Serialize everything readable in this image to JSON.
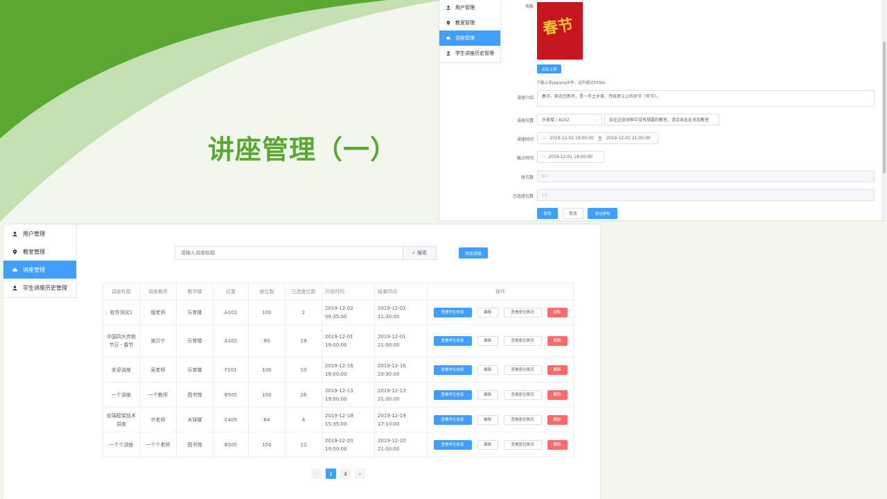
{
  "slide": {
    "title": "讲座管理（一）"
  },
  "colors": {
    "accent": "#409eff",
    "danger": "#f56c6c",
    "brand_green": "#5aa832"
  },
  "top_screenshot": {
    "menu": [
      {
        "label": "用户管理",
        "icon": "user-icon"
      },
      {
        "label": "教室管理",
        "icon": "location-icon"
      },
      {
        "label": "讲座管理",
        "icon": "cloud-icon",
        "active": true
      },
      {
        "label": "学生讲座历史管理",
        "icon": "user-icon"
      }
    ],
    "form": {
      "poster_label": "海报",
      "poster_text": "春节",
      "upload_button": "点击上传",
      "upload_tip": "只能上传jpg/png文件，且不超过500kb",
      "intro_label": "讲座介绍",
      "intro_value": "春节，即农历新年，是一年之岁首、传统意义上的岁节（年节）。",
      "location_label": "讲座位置",
      "location_value": "乐育楼 / A102",
      "location_tip": "如左边选项框中没有想要的教室，请点击此处添加教室",
      "time_label": "讲座时间",
      "time_start": "2019-12-01 19:00:00",
      "time_sep": "至",
      "time_end": "2019-12-01 21:00:00",
      "deadline_label": "截止时间",
      "deadline_value": "2019-12-01 18:00:00",
      "seats_label": "座位数",
      "seats_value": "60",
      "selected_label": "已选座位数",
      "selected_value": "19",
      "btn_modify": "修改",
      "btn_cancel": "取消",
      "btn_seat": "座位排布"
    }
  },
  "bottom_screenshot": {
    "menu": [
      {
        "label": "用户管理",
        "icon": "user-icon"
      },
      {
        "label": "教室管理",
        "icon": "location-icon"
      },
      {
        "label": "讲座管理",
        "icon": "cloud-icon",
        "active": true
      },
      {
        "label": "学生讲座历史管理",
        "icon": "user-icon"
      }
    ],
    "search": {
      "placeholder": "请输入讲座标题",
      "button": "搜索"
    },
    "add_button": "添加讲座",
    "table": {
      "headers": [
        "讲座标题",
        "讲座教师",
        "教学楼",
        "位置",
        "座位数",
        "已选座位数",
        "开始时间",
        "结束时间",
        "操作"
      ],
      "row_buttons": {
        "view": "查看学生信息",
        "edit": "编辑",
        "seats": "查看座位情况",
        "delete": "删除"
      },
      "rows": [
        {
          "title": "软件测试1",
          "teacher": "程老师",
          "building": "乐育楼",
          "room": "A102",
          "seats": "100",
          "selected": "2",
          "start": "2019-12-02 09:35:00",
          "end": "2019-12-02 11:30:00"
        },
        {
          "title": "中国四大传统节日 - 春节",
          "teacher": "谢贝宁",
          "building": "乐育楼",
          "room": "A102",
          "seats": "60",
          "selected": "19",
          "start": "2019-12-01 19:00:00",
          "end": "2019-12-01 21:00:00"
        },
        {
          "title": "安卓讲座",
          "teacher": "吴老师",
          "building": "乐育楼",
          "room": "F101",
          "seats": "100",
          "selected": "10",
          "start": "2019-12-16 19:00:00",
          "end": "2019-12-16 20:30:00"
        },
        {
          "title": "一个讲座",
          "teacher": "一个教师",
          "building": "图书馆",
          "room": "B505",
          "seats": "100",
          "selected": "26",
          "start": "2019-12-13 19:00:00",
          "end": "2019-12-13 21:00:00"
        },
        {
          "title": "前端框架技术讲座",
          "teacher": "许老师",
          "building": "木铎楼",
          "room": "C405",
          "seats": "64",
          "selected": "4",
          "start": "2019-12-19 15:35:00",
          "end": "2019-12-19 17:10:00"
        },
        {
          "title": "一个个讲座",
          "teacher": "一个个老师",
          "building": "图书馆",
          "room": "B505",
          "seats": "150",
          "selected": "12",
          "start": "2019-12-20 19:00:00",
          "end": "2019-12-20 21:00:00"
        }
      ]
    },
    "pagination": {
      "prev": "‹",
      "pages": [
        "1",
        "2"
      ],
      "current": "1",
      "next": "›"
    }
  }
}
